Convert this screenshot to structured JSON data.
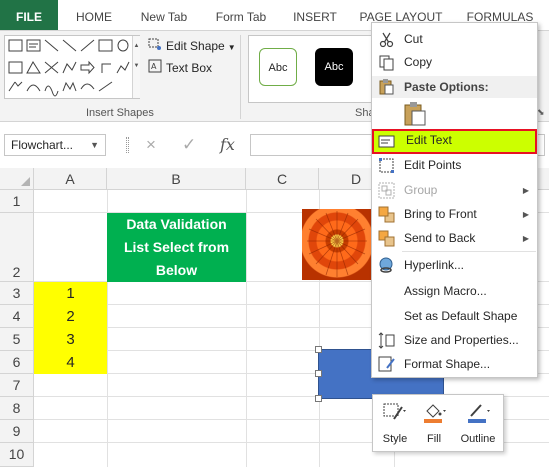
{
  "ribbon": {
    "tabs": [
      {
        "label": "FILE"
      },
      {
        "label": "HOME"
      },
      {
        "label": "New Tab"
      },
      {
        "label": "Form Tab"
      },
      {
        "label": "INSERT"
      },
      {
        "label": "PAGE LAYOUT"
      },
      {
        "label": "FORMULAS"
      }
    ],
    "insert_shapes": {
      "edit_shape_label": "Edit Shape",
      "text_box_label": "Text Box",
      "group_label": "Insert Shapes"
    },
    "shape_styles": {
      "swatch_1": "Abc",
      "swatch_2": "Abc",
      "group_label_partial": "Sha"
    }
  },
  "formula_bar": {
    "name_box_value": "Flowchart...",
    "cancel_icon": "×",
    "enter_icon": "✓",
    "fx_label": "fx",
    "formula_value": ""
  },
  "grid": {
    "columns": [
      "A",
      "B",
      "C",
      "D"
    ],
    "rows": [
      "1",
      "2",
      "3",
      "4",
      "5",
      "6",
      "7",
      "8",
      "9",
      "10"
    ],
    "a3": "1",
    "a4": "2",
    "a5": "3",
    "a6": "4",
    "green_box_lines": [
      "Data Validation",
      "List Select from",
      "Below"
    ]
  },
  "context_menu": {
    "cut": "Cut",
    "copy": "Copy",
    "paste_options": "Paste Options:",
    "edit_text": "Edit Text",
    "edit_points": "Edit Points",
    "group": "Group",
    "bring_to_front": "Bring to Front",
    "send_to_back": "Send to Back",
    "hyperlink": "Hyperlink...",
    "assign_macro": "Assign Macro...",
    "set_default_shape": "Set as Default Shape",
    "size_properties": "Size and Properties...",
    "format_shape": "Format Shape..."
  },
  "mini_toolbar": {
    "style": "Style",
    "fill": "Fill",
    "outline": "Outline"
  },
  "colors": {
    "file_tab": "#217346",
    "green_box": "#00b050",
    "yellow_cells": "#ffff00",
    "selected_shape": "#4472c4",
    "highlight_fill": "#ccff00",
    "highlight_border": "#e81123",
    "fill_accent": "#ed7d31",
    "outline_accent": "#4472c4"
  }
}
